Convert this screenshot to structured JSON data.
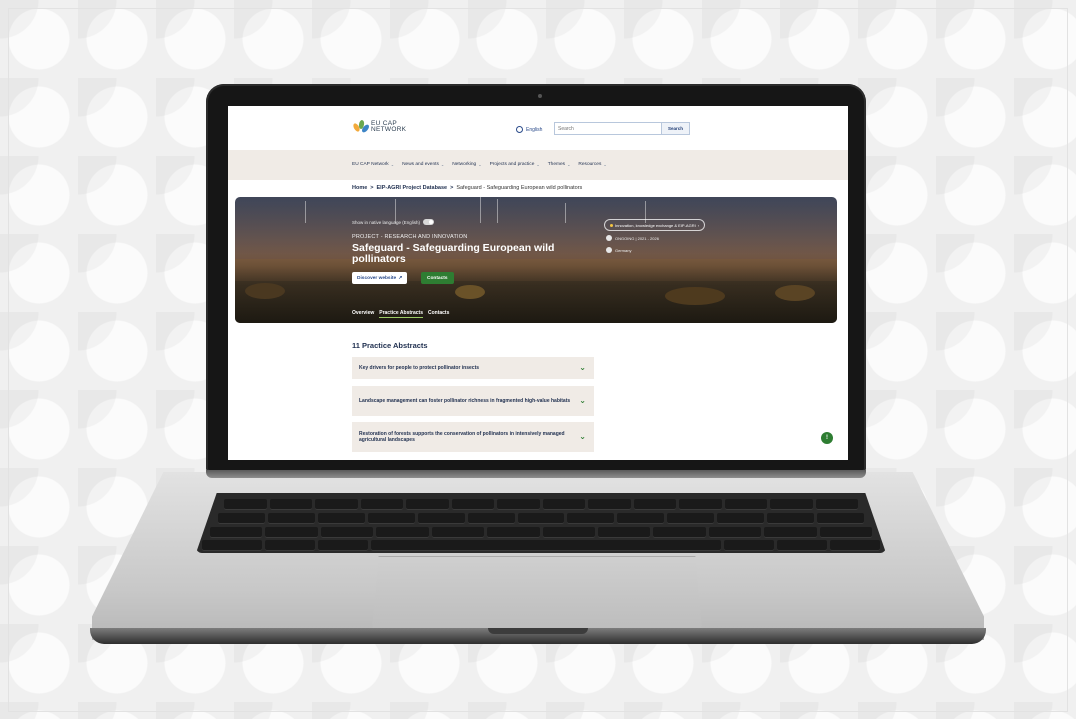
{
  "site": {
    "logo": {
      "line1": "EU CAP",
      "line2": "NETWORK"
    },
    "language_label": "English",
    "search": {
      "placeholder": "Search",
      "button": "Search"
    }
  },
  "nav": {
    "items": [
      "EU CAP Network",
      "News and events",
      "Networking",
      "Projects and practice",
      "Themes",
      "Resources"
    ]
  },
  "breadcrumb": {
    "items": [
      "Home",
      "EIP-AGRI Project Database"
    ],
    "current": "Safeguard - Safeguarding European wild pollinators",
    "separator": ">"
  },
  "hero": {
    "native_toggle_label": "Show in native language (English)",
    "eyebrow": "PROJECT - RESEARCH AND INNOVATION",
    "title": "Safeguard - Safeguarding European wild pollinators",
    "discover_button": "Discover website",
    "contacts_button": "Contacts",
    "theme_pill": "Innovation, knowledge exchange & EIP-AGRI",
    "status": "ONGOING | 2021 - 2026",
    "country": "Germany",
    "tabs": [
      "Overview",
      "Practice Abstracts",
      "Contacts"
    ],
    "active_tab": "Practice Abstracts"
  },
  "abstracts": {
    "heading": "11 Practice Abstracts",
    "items": [
      "Key drivers for people to protect pollinator insects",
      "Landscape management can foster pollinator richness in fragmented high-value habitats",
      "Restoration of forests supports the conservation of pollinators in intensively managed agricultural landscapes"
    ]
  },
  "colors": {
    "accent_green": "#2e7d32",
    "nav_bg": "#f0ebe6",
    "text_navy": "#1f2f4f"
  },
  "icons": [
    "globe-icon",
    "external-link-icon",
    "chevron-down-icon",
    "help-icon",
    "calendar-icon",
    "location-icon",
    "star-icon"
  ]
}
